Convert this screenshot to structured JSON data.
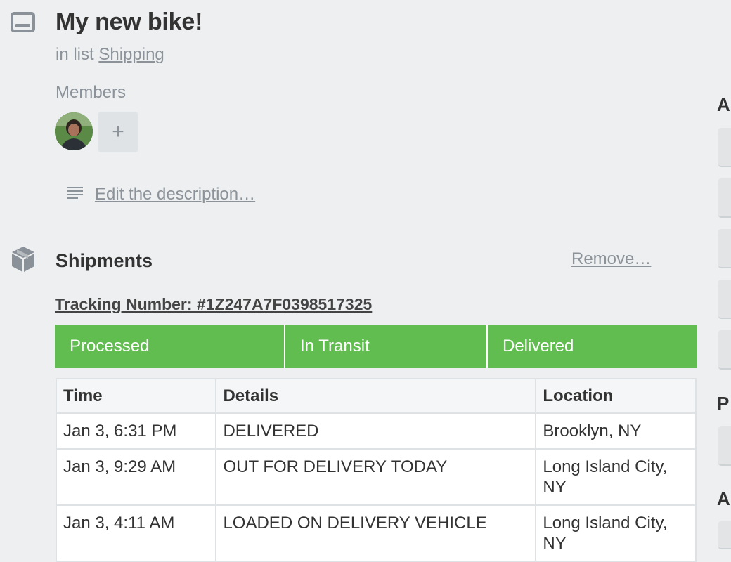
{
  "card": {
    "title": "My new bike!",
    "in_list_prefix": "in list",
    "list_name": "Shipping"
  },
  "members": {
    "label": "Members",
    "add_label": "+"
  },
  "description": {
    "edit_label": "Edit the description…"
  },
  "shipments": {
    "title": "Shipments",
    "remove_label": "Remove…",
    "tracking_label": "Tracking Number: #1Z247A7F0398517325",
    "statuses": [
      "Processed",
      "In Transit",
      "Delivered"
    ],
    "status_color": "#61bd4f",
    "table": {
      "headers": [
        "Time",
        "Details",
        "Location"
      ],
      "rows": [
        {
          "time": "Jan 3, 6:31 PM",
          "details": "DELIVERED",
          "location": "Brooklyn, NY"
        },
        {
          "time": "Jan 3, 9:29 AM",
          "details": "OUT FOR DELIVERY TODAY",
          "location": "Long Island City, NY"
        },
        {
          "time": "Jan 3, 4:11 AM",
          "details": "LOADED ON DELIVERY VEHICLE",
          "location": "Long Island City, NY"
        }
      ]
    }
  },
  "sidebar": {
    "headings": [
      "A",
      "P",
      "A"
    ]
  }
}
